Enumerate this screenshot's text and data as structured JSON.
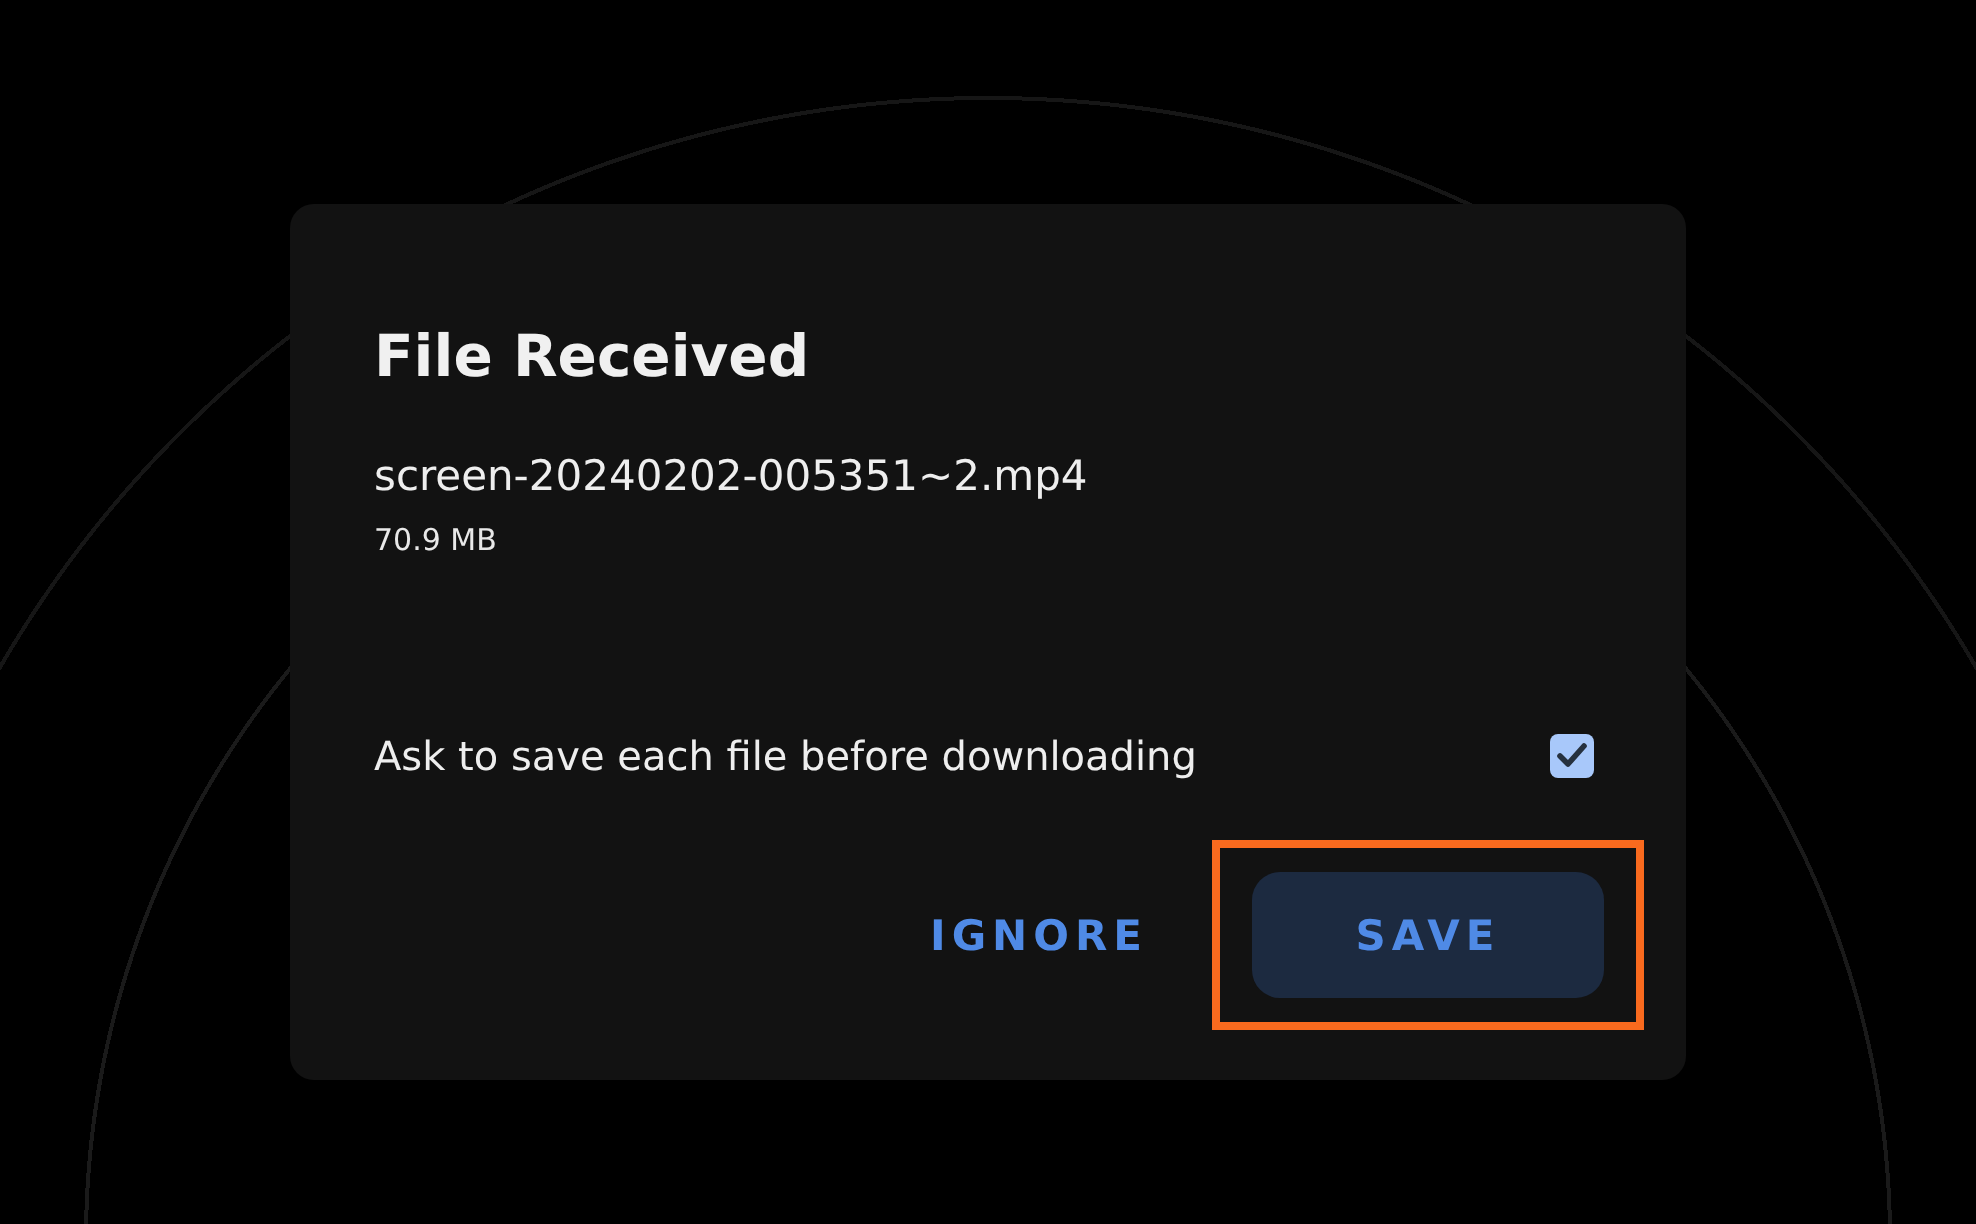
{
  "dialog": {
    "title": "File Received",
    "file_name": "screen-20240202-005351~2.mp4",
    "file_size": "70.9 MB",
    "option": {
      "label": "Ask to save each file before downloading",
      "checked": true
    },
    "buttons": [
      {
        "label": "IGNORE",
        "kind": "text",
        "highlighted": false
      },
      {
        "label": "SAVE",
        "kind": "filled",
        "highlighted": true
      }
    ]
  }
}
